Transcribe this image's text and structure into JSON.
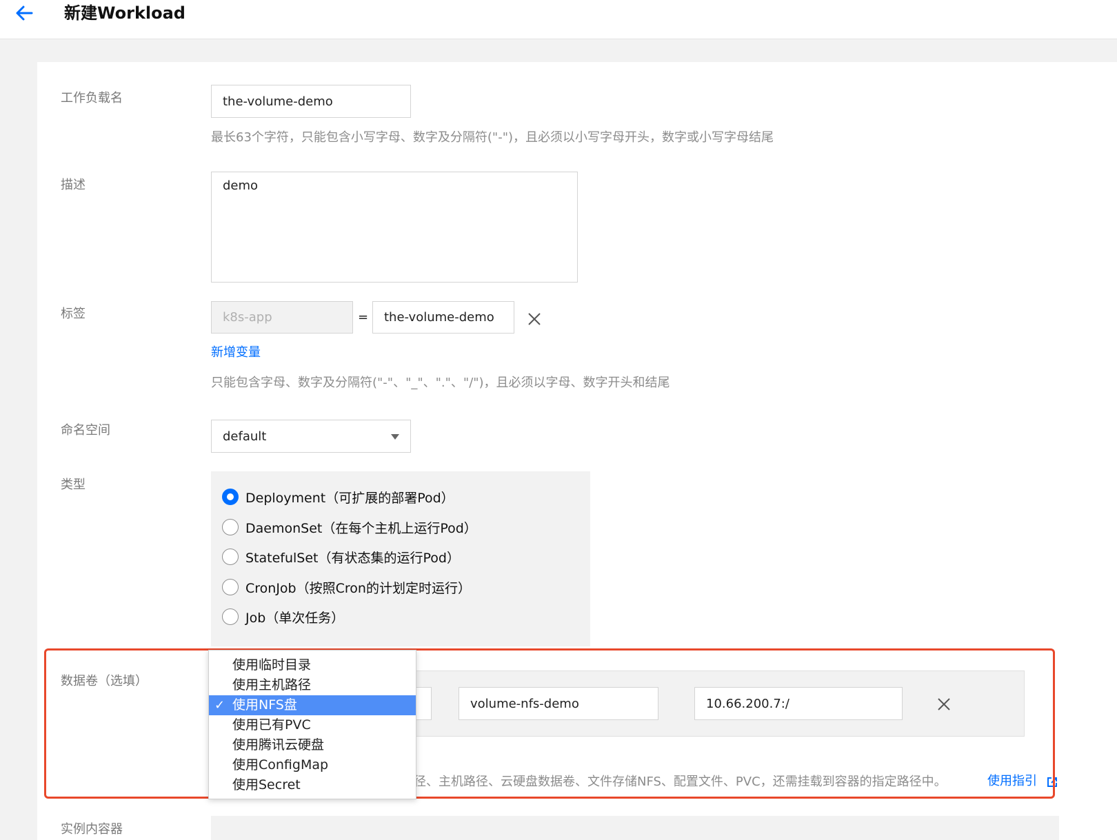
{
  "header": {
    "title": "新建Workload"
  },
  "form": {
    "name": {
      "label": "工作负载名",
      "value": "the-volume-demo",
      "hint": "最长63个字符，只能包含小写字母、数字及分隔符(\"-\")，且必须以小写字母开头，数字或小写字母结尾"
    },
    "desc": {
      "label": "描述",
      "value": "demo"
    },
    "tags": {
      "label": "标签",
      "key": "k8s-app",
      "eq": "=",
      "value": "the-volume-demo",
      "add_link": "新增变量",
      "hint": "只能包含字母、数字及分隔符(\"-\"、\"_\"、\".\"、\"/\")，且必须以字母、数字开头和结尾"
    },
    "namespace": {
      "label": "命名空间",
      "value": "default"
    },
    "type": {
      "label": "类型",
      "options": [
        {
          "label": "Deployment（可扩展的部署Pod）",
          "checked": true
        },
        {
          "label": "DaemonSet（在每个主机上运行Pod）",
          "checked": false
        },
        {
          "label": "StatefulSet（有状态集的运行Pod）",
          "checked": false
        },
        {
          "label": "CronJob（按照Cron的计划定时运行）",
          "checked": false
        },
        {
          "label": "Job（单次任务）",
          "checked": false
        }
      ]
    },
    "volume": {
      "label": "数据卷（选填）",
      "name_value": "volume-nfs-demo",
      "path_value": "10.66.200.7:/",
      "hint": "径、主机路径、云硬盘数据卷、文件存储NFS、配置文件、PVC，还需挂载到容器的指定路径中。",
      "guide_link": "使用指引",
      "dropdown": [
        {
          "label": "使用临时目录",
          "selected": false
        },
        {
          "label": "使用主机路径",
          "selected": false
        },
        {
          "label": "使用NFS盘",
          "selected": true
        },
        {
          "label": "使用已有PVC",
          "selected": false
        },
        {
          "label": "使用腾讯云硬盘",
          "selected": false
        },
        {
          "label": "使用ConfigMap",
          "selected": false
        },
        {
          "label": "使用Secret",
          "selected": false
        }
      ],
      "check_mark": "✓"
    },
    "containers": {
      "label": "实例内容器"
    }
  },
  "colors": {
    "accent": "#006eff",
    "highlight": "#e8482b",
    "selected_bg": "#4f8ef7"
  }
}
